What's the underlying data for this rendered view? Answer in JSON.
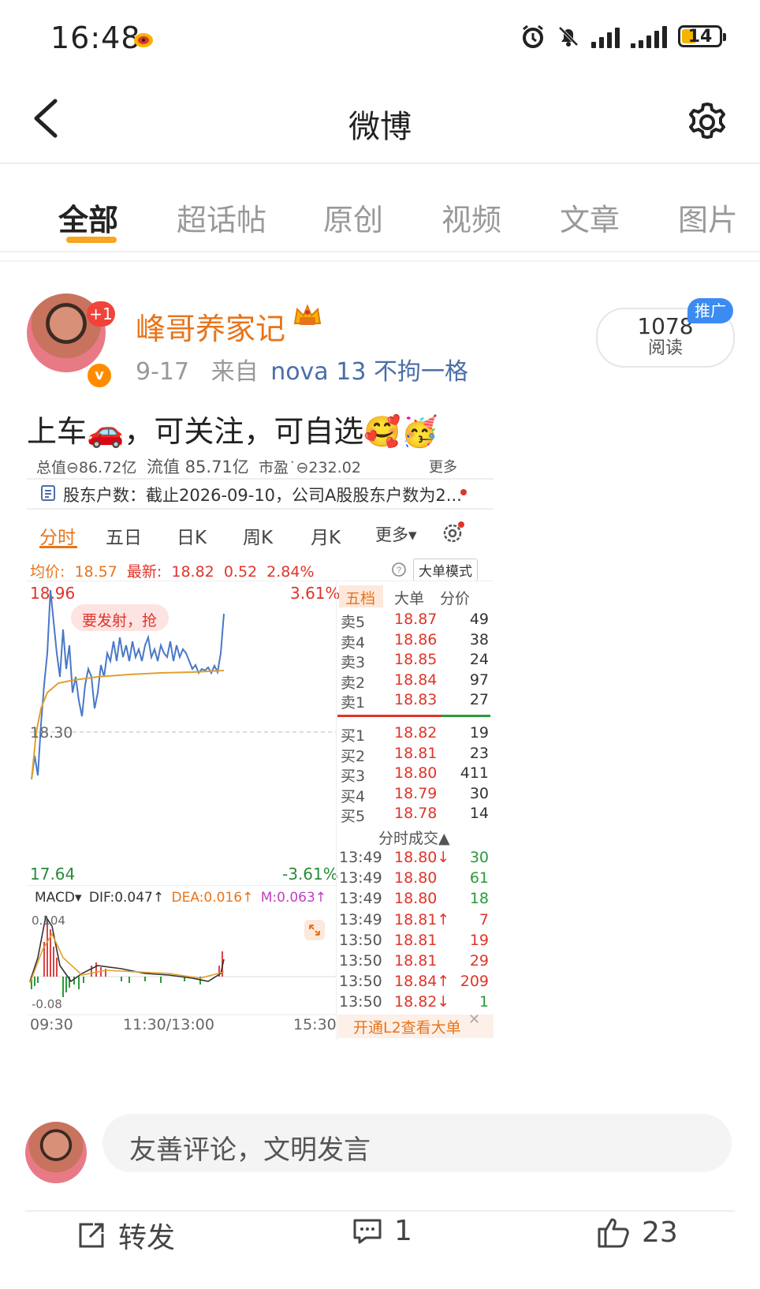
{
  "status": {
    "time": "16:48",
    "battery": "14"
  },
  "header": {
    "title": "微博"
  },
  "tabs": [
    {
      "label": "全部"
    },
    {
      "label": "超话帖"
    },
    {
      "label": "原创"
    },
    {
      "label": "视频"
    },
    {
      "label": "文章"
    },
    {
      "label": "图片"
    }
  ],
  "post": {
    "author": "峰哥养家记",
    "avatar_badge": "+1",
    "date": "9-17",
    "source_prefix": "来自",
    "device": "nova 13 不拘一格",
    "reads": "1078",
    "reads_label": "阅读",
    "promo_badge": "推广",
    "text": "上车🚗，可关注，可自选🥰🥳"
  },
  "stock": {
    "summary": {
      "total": "总值⊖86.72亿",
      "float": "流值 85.71亿",
      "pe": "市盈˙⊖232.02",
      "more": "更多"
    },
    "notice": "股东户数：截止2026-09-10，公司A股股东户数为2...",
    "tabs": [
      "分时",
      "五日",
      "日K",
      "周K",
      "月K",
      "更多▾"
    ],
    "quote": {
      "avg_label": "均价:",
      "avg": "18.57",
      "latest_label": "最新:",
      "latest": "18.82",
      "change": "0.52",
      "pct": "2.84%",
      "mode": "大单模式"
    },
    "axis": {
      "top": "18.96",
      "top_pct": "3.61%",
      "mid": "18.30",
      "bottom": "17.64",
      "bottom_pct": "-3.61%",
      "annotation": "要发射，抢"
    },
    "orderbook_tabs": [
      "五档",
      "大单",
      "分价"
    ],
    "asks": [
      {
        "label": "卖5",
        "price": "18.87",
        "vol": "49"
      },
      {
        "label": "卖4",
        "price": "18.86",
        "vol": "38"
      },
      {
        "label": "卖3",
        "price": "18.85",
        "vol": "24"
      },
      {
        "label": "卖2",
        "price": "18.84",
        "vol": "97"
      },
      {
        "label": "卖1",
        "price": "18.83",
        "vol": "27"
      }
    ],
    "bids": [
      {
        "label": "买1",
        "price": "18.82",
        "vol": "19"
      },
      {
        "label": "买2",
        "price": "18.81",
        "vol": "23"
      },
      {
        "label": "买3",
        "price": "18.80",
        "vol": "411"
      },
      {
        "label": "买4",
        "price": "18.79",
        "vol": "30"
      },
      {
        "label": "买5",
        "price": "18.78",
        "vol": "14"
      }
    ],
    "trades_title": "分时成交▲",
    "trades": [
      {
        "time": "13:49",
        "price": "18.80↓",
        "vol": "30",
        "dir": "down"
      },
      {
        "time": "13:49",
        "price": "18.80",
        "vol": "61",
        "dir": "down"
      },
      {
        "time": "13:49",
        "price": "18.80",
        "vol": "18",
        "dir": "down"
      },
      {
        "time": "13:49",
        "price": "18.81↑",
        "vol": "7",
        "dir": "up"
      },
      {
        "time": "13:50",
        "price": "18.81",
        "vol": "19",
        "dir": "up"
      },
      {
        "time": "13:50",
        "price": "18.81",
        "vol": "29",
        "dir": "up"
      },
      {
        "time": "13:50",
        "price": "18.84↑",
        "vol": "209",
        "dir": "up"
      },
      {
        "time": "13:50",
        "price": "18.82↓",
        "vol": "1",
        "dir": "down"
      }
    ],
    "macd": {
      "label": "MACD▾",
      "dif": "DIF:0.047↑",
      "dea": "DEA:0.016↑",
      "m": "M:0.063↑",
      "top": "0.104",
      "bottom": "-0.08"
    },
    "time_axis": [
      "09:30",
      "11:30/13:00",
      "15:30"
    ],
    "l2": "开通L2查看大单"
  },
  "comment": {
    "placeholder": "友善评论，文明发言"
  },
  "actions": {
    "repost": "转发",
    "comments": "1",
    "likes": "23"
  }
}
